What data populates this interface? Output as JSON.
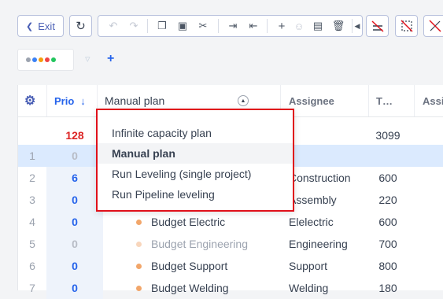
{
  "toolbar": {
    "exit_label": "Exit",
    "exit_icon": "chevron-left-icon",
    "icons": [
      "refresh-icon",
      "undo-icon",
      "redo-icon",
      "copy-icon",
      "copy-dashed-icon",
      "cut-icon",
      "indent-icon",
      "outdent-icon",
      "add-icon",
      "add-resource-icon",
      "form-icon",
      "trash-icon",
      "left-arrow-icon",
      "baseline-icon",
      "strike-diagonal-icon",
      "strike-cross-icon"
    ]
  },
  "filters": {
    "color_dots": [
      "#9ca3af",
      "#3b82f6",
      "#f59e0b",
      "#ef4444",
      "#22c55e"
    ],
    "add_label": "+"
  },
  "grid": {
    "headers": {
      "prio": "Prio",
      "prio_sort": "↓",
      "name": "Manual plan",
      "assignee": "Assignee",
      "t": "T…",
      "assi": "Assi"
    },
    "summary": {
      "prio": "128",
      "t": "3099"
    },
    "rows": [
      {
        "num": "1",
        "prio": "0",
        "name": "",
        "assignee": "",
        "t": ""
      },
      {
        "num": "2",
        "prio": "6",
        "name": "",
        "assignee": "Construction",
        "t": "600"
      },
      {
        "num": "3",
        "prio": "0",
        "name": "",
        "assignee": "Assembly",
        "t": "220"
      },
      {
        "num": "4",
        "prio": "0",
        "name": "Budget Electric",
        "assignee": "Elelectric",
        "t": "600"
      },
      {
        "num": "5",
        "prio": "0",
        "name": "Budget Engineering",
        "assignee": "Engineering",
        "t": "700"
      },
      {
        "num": "6",
        "prio": "0",
        "name": "Budget Support",
        "assignee": "Support",
        "t": "800"
      },
      {
        "num": "7",
        "prio": "0",
        "name": "Budget Welding",
        "assignee": "Welding",
        "t": "180"
      }
    ]
  },
  "dropdown": {
    "options": [
      "Infinite capacity plan",
      "Manual plan",
      "Run Leveling (single project)",
      "Run Pipeline leveling"
    ],
    "selected": "Manual plan"
  }
}
